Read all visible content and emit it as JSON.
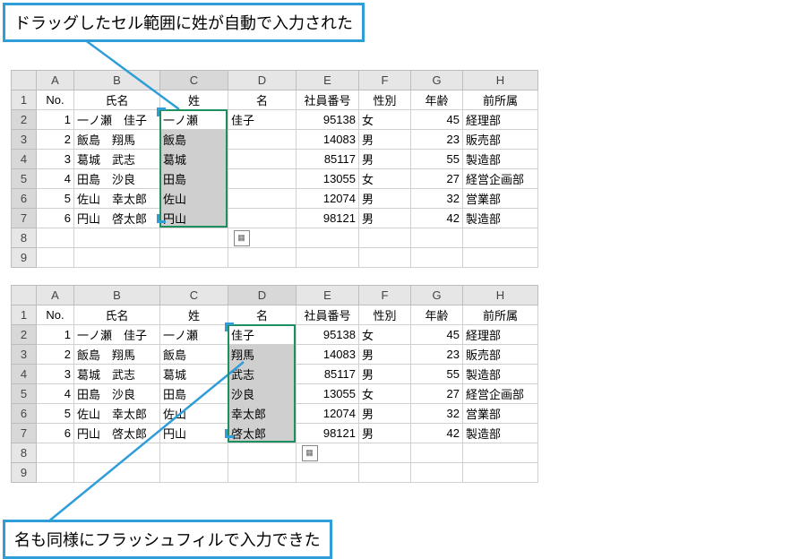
{
  "callouts": {
    "top": "ドラッグしたセル範囲に姓が自動で入力された",
    "bottom": "名も同様にフラッシュフィルで入力できた"
  },
  "columns": [
    "A",
    "B",
    "C",
    "D",
    "E",
    "F",
    "G",
    "H"
  ],
  "headers": {
    "no": "No.",
    "name": "氏名",
    "sei": "姓",
    "mei": "名",
    "empno": "社員番号",
    "gender": "性別",
    "age": "年齢",
    "dept": "前所属"
  },
  "sheet1": {
    "rows": [
      {
        "no": "1",
        "name": "一ノ瀬　佳子",
        "sei": "一ノ瀬",
        "mei": "佳子",
        "emp": "95138",
        "g": "女",
        "age": "45",
        "dept": "経理部"
      },
      {
        "no": "2",
        "name": "飯島　翔馬",
        "sei": "飯島",
        "mei": "",
        "emp": "14083",
        "g": "男",
        "age": "23",
        "dept": "販売部"
      },
      {
        "no": "3",
        "name": "葛城　武志",
        "sei": "葛城",
        "mei": "",
        "emp": "85117",
        "g": "男",
        "age": "55",
        "dept": "製造部"
      },
      {
        "no": "4",
        "name": "田島　沙良",
        "sei": "田島",
        "mei": "",
        "emp": "13055",
        "g": "女",
        "age": "27",
        "dept": "経営企画部"
      },
      {
        "no": "5",
        "name": "佐山　幸太郎",
        "sei": "佐山",
        "mei": "",
        "emp": "12074",
        "g": "男",
        "age": "32",
        "dept": "営業部"
      },
      {
        "no": "6",
        "name": "円山　啓太郎",
        "sei": "円山",
        "mei": "",
        "emp": "98121",
        "g": "男",
        "age": "42",
        "dept": "製造部"
      }
    ],
    "selCol": "C"
  },
  "sheet2": {
    "rows": [
      {
        "no": "1",
        "name": "一ノ瀬　佳子",
        "sei": "一ノ瀬",
        "mei": "佳子",
        "emp": "95138",
        "g": "女",
        "age": "45",
        "dept": "経理部"
      },
      {
        "no": "2",
        "name": "飯島　翔馬",
        "sei": "飯島",
        "mei": "翔馬",
        "emp": "14083",
        "g": "男",
        "age": "23",
        "dept": "販売部"
      },
      {
        "no": "3",
        "name": "葛城　武志",
        "sei": "葛城",
        "mei": "武志",
        "emp": "85117",
        "g": "男",
        "age": "55",
        "dept": "製造部"
      },
      {
        "no": "4",
        "name": "田島　沙良",
        "sei": "田島",
        "mei": "沙良",
        "emp": "13055",
        "g": "女",
        "age": "27",
        "dept": "経営企画部"
      },
      {
        "no": "5",
        "name": "佐山　幸太郎",
        "sei": "佐山",
        "mei": "幸太郎",
        "emp": "12074",
        "g": "男",
        "age": "32",
        "dept": "営業部"
      },
      {
        "no": "6",
        "name": "円山　啓太郎",
        "sei": "円山",
        "mei": "啓太郎",
        "emp": "98121",
        "g": "男",
        "age": "42",
        "dept": "製造部"
      }
    ],
    "selCol": "D"
  }
}
